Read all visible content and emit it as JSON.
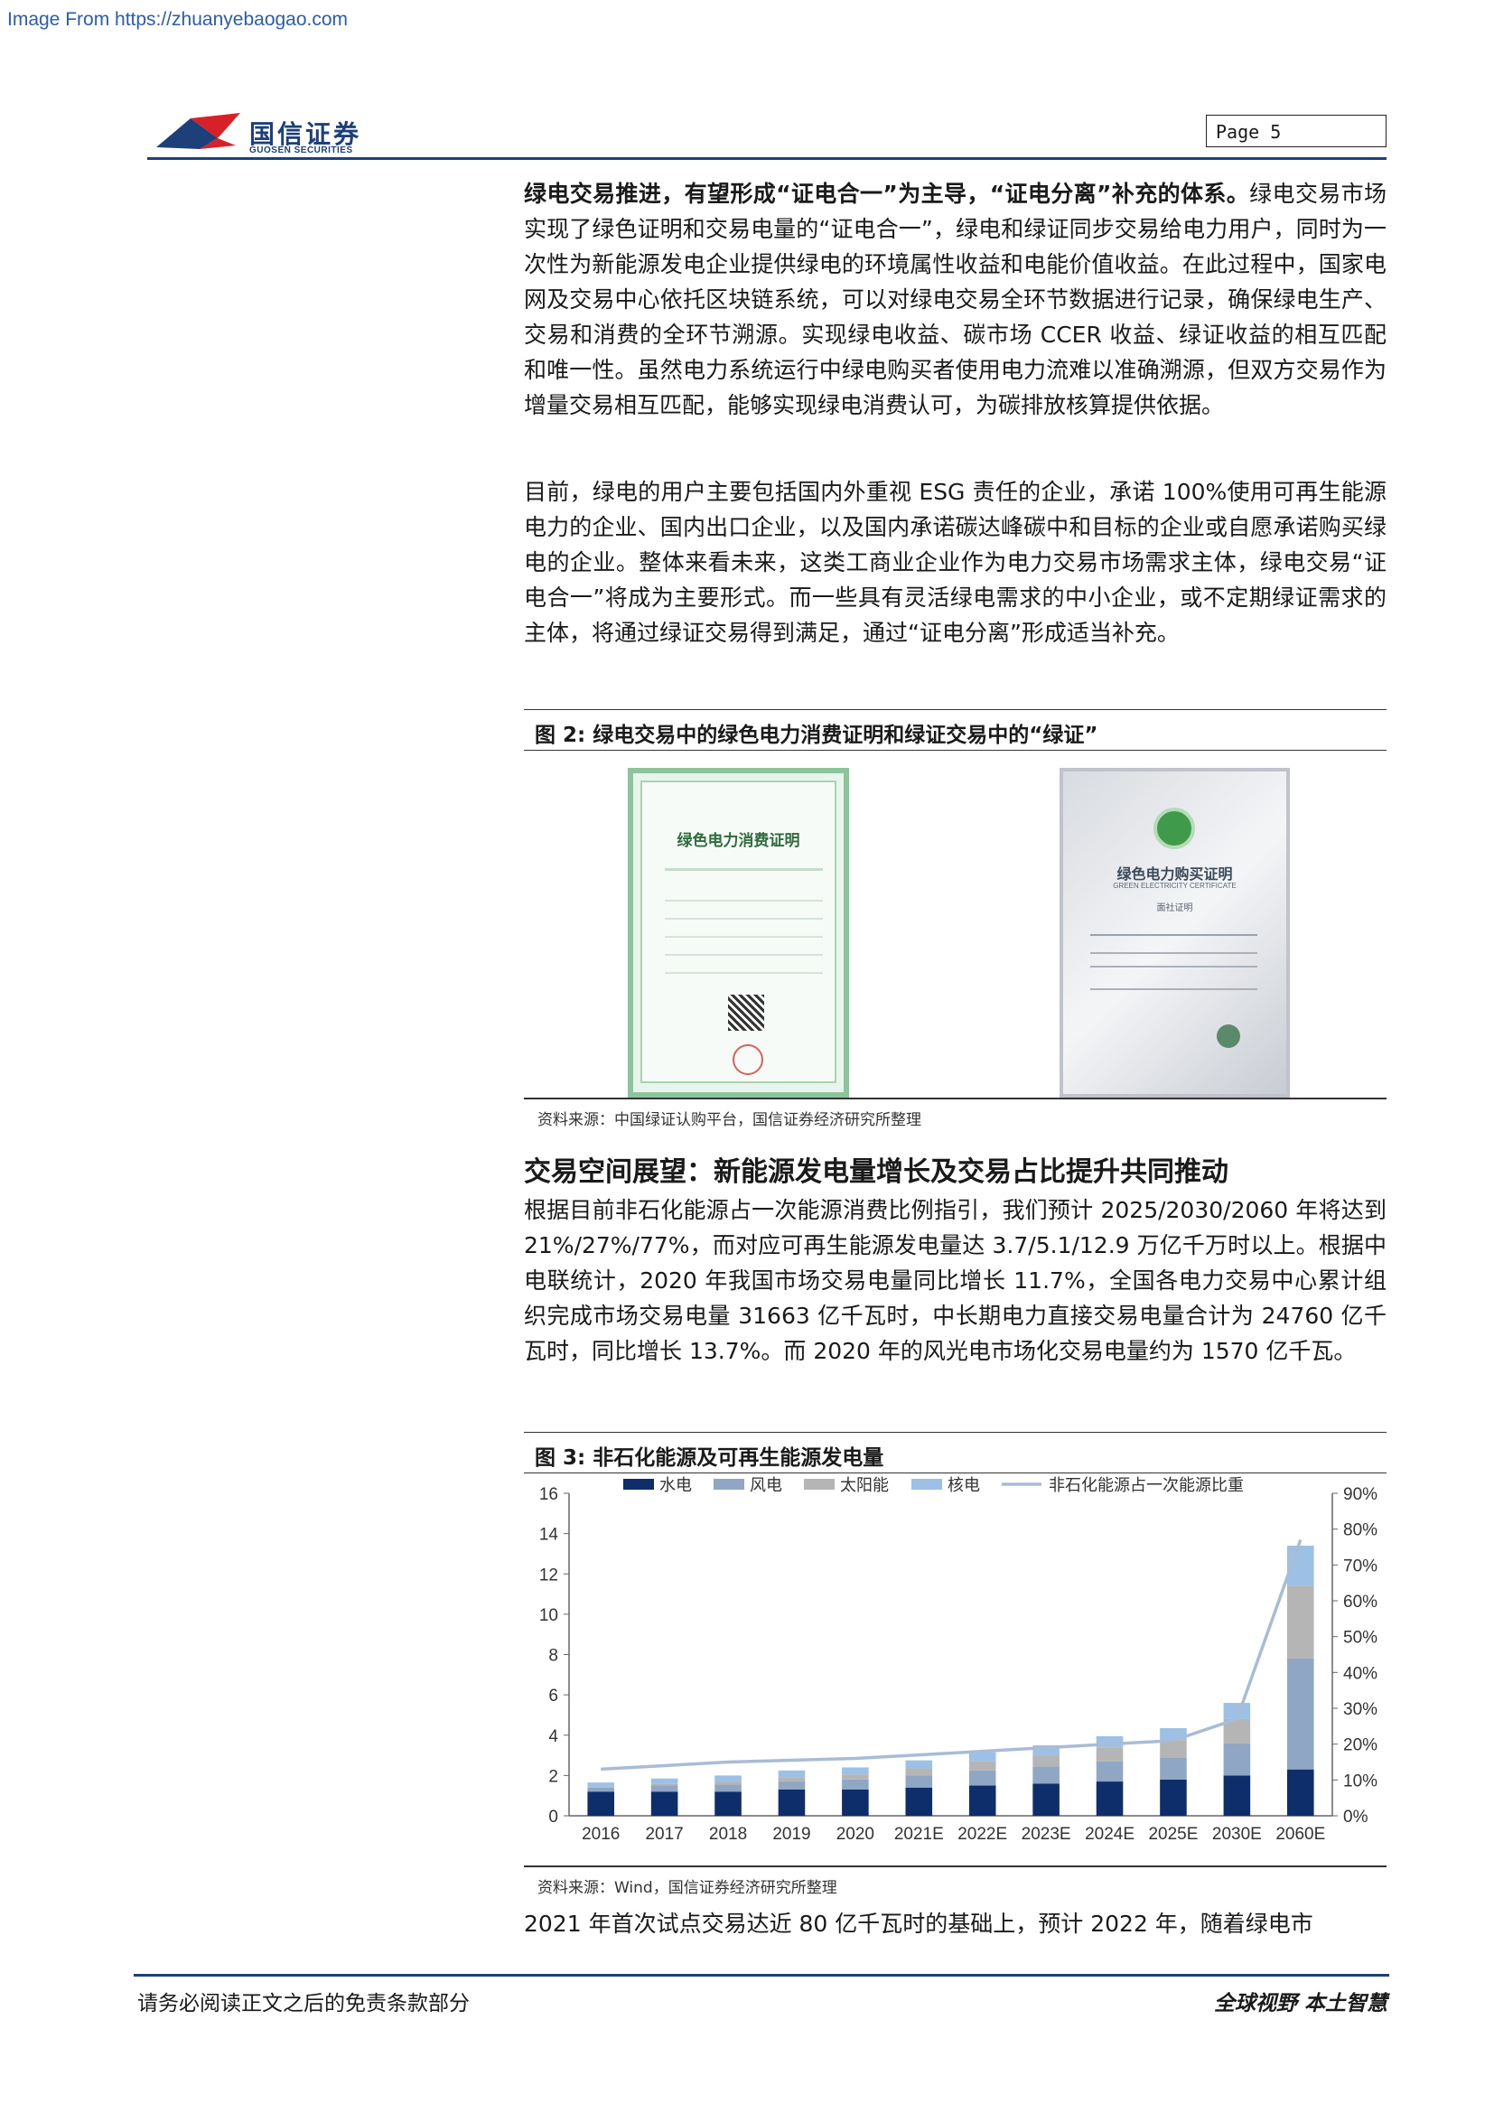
{
  "watermark": "Image From https://zhuanyebaogao.com",
  "header": {
    "logo_cn": "国信证券",
    "logo_en": "GUOSEN SECURITIES",
    "page_label": "Page  5"
  },
  "para1": {
    "lead": "绿电交易推进，有望形成“证电合一”为主导，“证电分离”补充的体系。",
    "body": "绿电交易市场实现了绿色证明和交易电量的“证电合一”，绿电和绿证同步交易给电力用户，同时为一次性为新能源发电企业提供绿电的环境属性收益和电能价值收益。在此过程中，国家电网及交易中心依托区块链系统，可以对绿电交易全环节数据进行记录，确保绿电生产、交易和消费的全环节溯源。实现绿电收益、碳市场 CCER 收益、绿证收益的相互匹配和唯一性。虽然电力系统运行中绿电购买者使用电力流难以准确溯源，但双方交易作为增量交易相互匹配，能够实现绿电消费认可，为碳排放核算提供依据。"
  },
  "para2": "目前，绿电的用户主要包括国内外重视 ESG 责任的企业，承诺 100%使用可再生能源电力的企业、国内出口企业，以及国内承诺碳达峰碳中和目标的企业或自愿承诺购买绿电的企业。整体来看未来，这类工商业企业作为电力交易市场需求主体，绿电交易“证电合一”将成为主要形式。而一些具有灵活绿电需求的中小企业，或不定期绿证需求的主体，将通过绿证交易得到满足，通过“证电分离”形成适当补充。",
  "fig2": {
    "title": "图 2:  绿电交易中的绿色电力消费证明和绿证交易中的“绿证”",
    "cert1_title": "绿色电力消费证明",
    "cert2_title": "绿色电力购买证明",
    "cert2_sub": "GREEN ELECTRICITY CERTIFICATE",
    "cert2_sub2": "面社证明",
    "source": "资料来源：中国绿证认购平台，国信证券经济研究所整理"
  },
  "section": {
    "heading": "交易空间展望：新能源发电量增长及交易占比提升共同推动",
    "body": "根据目前非石化能源占一次能源消费比例指引，我们预计 2025/2030/2060 年将达到 21%/27%/77%，而对应可再生能源发电量达 3.7/5.1/12.9 万亿千万时以上。根据中电联统计，2020 年我国市场交易电量同比增长 11.7%，全国各电力交易中心累计组织完成市场交易电量 31663 亿千瓦时，中长期电力直接交易电量合计为 24760 亿千瓦时，同比增长 13.7%。而 2020 年的风光电市场化交易电量约为 1570 亿千瓦。"
  },
  "fig3": {
    "title": "图 3:  非石化能源及可再生能源发电量",
    "source": "资料来源：Wind，国信证券经济研究所整理"
  },
  "chart_data": {
    "type": "bar",
    "stacked": true,
    "categories": [
      "2016",
      "2017",
      "2018",
      "2019",
      "2020",
      "2021E",
      "2022E",
      "2023E",
      "2024E",
      "2025E",
      "2030E",
      "2060E"
    ],
    "series": [
      {
        "name": "水电",
        "color": "#0d2d6b",
        "values": [
          1.2,
          1.2,
          1.2,
          1.3,
          1.3,
          1.4,
          1.5,
          1.6,
          1.7,
          1.8,
          2.0,
          2.3
        ]
      },
      {
        "name": "风电",
        "color": "#8fa6c4",
        "values": [
          0.2,
          0.3,
          0.35,
          0.4,
          0.5,
          0.6,
          0.75,
          0.85,
          1.0,
          1.1,
          1.6,
          5.5
        ]
      },
      {
        "name": "太阳能",
        "color": "#b5b5b5",
        "values": [
          0.05,
          0.1,
          0.15,
          0.2,
          0.25,
          0.35,
          0.45,
          0.55,
          0.7,
          0.85,
          1.2,
          3.6
        ]
      },
      {
        "name": "核电",
        "color": "#9cc0e6",
        "values": [
          0.2,
          0.25,
          0.3,
          0.35,
          0.35,
          0.4,
          0.45,
          0.5,
          0.55,
          0.6,
          0.8,
          2.0
        ]
      }
    ],
    "line": {
      "name": "非石化能源占一次能源比重",
      "color": "#a9bcd6",
      "values": [
        13,
        14,
        15,
        15.5,
        16,
        17,
        18,
        19,
        20,
        21,
        27,
        77
      ]
    },
    "ylim": [
      0,
      16
    ],
    "yticks": [
      0,
      2,
      4,
      6,
      8,
      10,
      12,
      14,
      16
    ],
    "y2lim": [
      0,
      90
    ],
    "y2ticks": [
      "0%",
      "10%",
      "20%",
      "30%",
      "40%",
      "50%",
      "60%",
      "70%",
      "80%",
      "90%"
    ],
    "legend_position": "top"
  },
  "para3": "2021 年首次试点交易达近 80 亿千瓦时的基础上，预计 2022 年，随着绿电市",
  "footer": {
    "left": "请务必阅读正文之后的免责条款部分",
    "right": "全球视野   本土智慧"
  }
}
